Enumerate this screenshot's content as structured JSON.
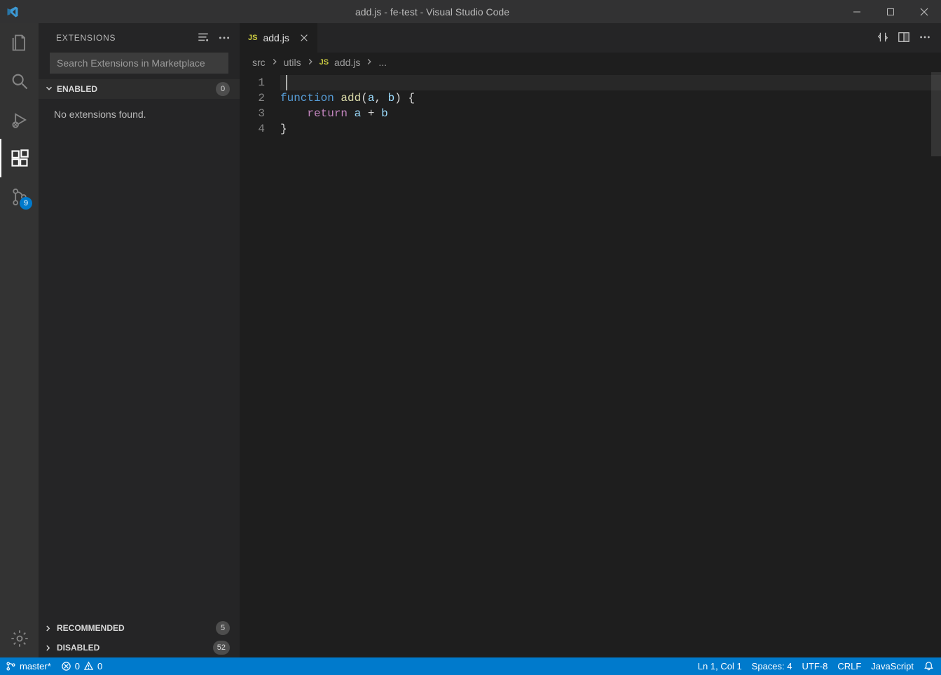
{
  "title": "add.js - fe-test - Visual Studio Code",
  "activitybar": {
    "scm_badge": "9"
  },
  "sidebar": {
    "title": "EXTENSIONS",
    "search_placeholder": "Search Extensions in Marketplace",
    "sections": {
      "enabled": {
        "label": "ENABLED",
        "count": "0",
        "empty_text": "No extensions found."
      },
      "recommended": {
        "label": "RECOMMENDED",
        "count": "5"
      },
      "disabled": {
        "label": "DISABLED",
        "count": "52"
      }
    }
  },
  "tab": {
    "filename": "add.js"
  },
  "breadcrumb": {
    "seg0": "src",
    "seg1": "utils",
    "seg2": "add.js",
    "seg3": "..."
  },
  "code": {
    "line_numbers": [
      "1",
      "2",
      "3",
      "4"
    ],
    "l2": {
      "kw": "function",
      "sp": " ",
      "fname": "add",
      "open": "(",
      "a": "a",
      "comma": ",",
      "sp2": " ",
      "b": "b",
      "close": ")",
      "sp3": " ",
      "brace": "{"
    },
    "l3": {
      "indent": "    ",
      "kw": "return",
      "sp": " ",
      "a": "a",
      "sp2": " ",
      "op": "+",
      "sp3": " ",
      "b": "b"
    },
    "l4": {
      "brace": "}"
    }
  },
  "status": {
    "branch": "master*",
    "errors": "0",
    "warnings": "0",
    "position": "Ln 1, Col 1",
    "spaces": "Spaces: 4",
    "encoding": "UTF-8",
    "eol": "CRLF",
    "language": "JavaScript"
  }
}
